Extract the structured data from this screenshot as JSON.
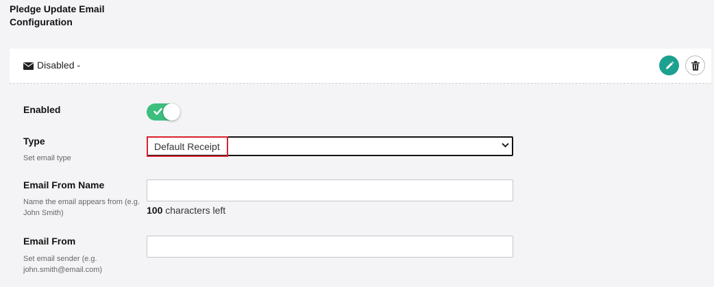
{
  "section": {
    "title": "Pledge Update Email Configuration"
  },
  "header": {
    "status_label": "Disabled -",
    "icon": "envelope-icon"
  },
  "actions": {
    "edit_icon": "pencil-icon",
    "delete_icon": "trash-icon",
    "edit_color": "#1ca08f"
  },
  "form": {
    "enabled": {
      "label": "Enabled",
      "value": true,
      "color": "#3cbf7e"
    },
    "type": {
      "label": "Type",
      "help": "Set email type",
      "selected": "Default Receipt"
    },
    "from_name": {
      "label": "Email From Name",
      "help": "Name the email appears from (e.g. John Smith)",
      "value": "",
      "chars_left_count": "100",
      "chars_left_text": " characters left"
    },
    "from_email": {
      "label": "Email From",
      "help": "Set email sender (e.g. john.smith@email.com)",
      "value": ""
    }
  }
}
